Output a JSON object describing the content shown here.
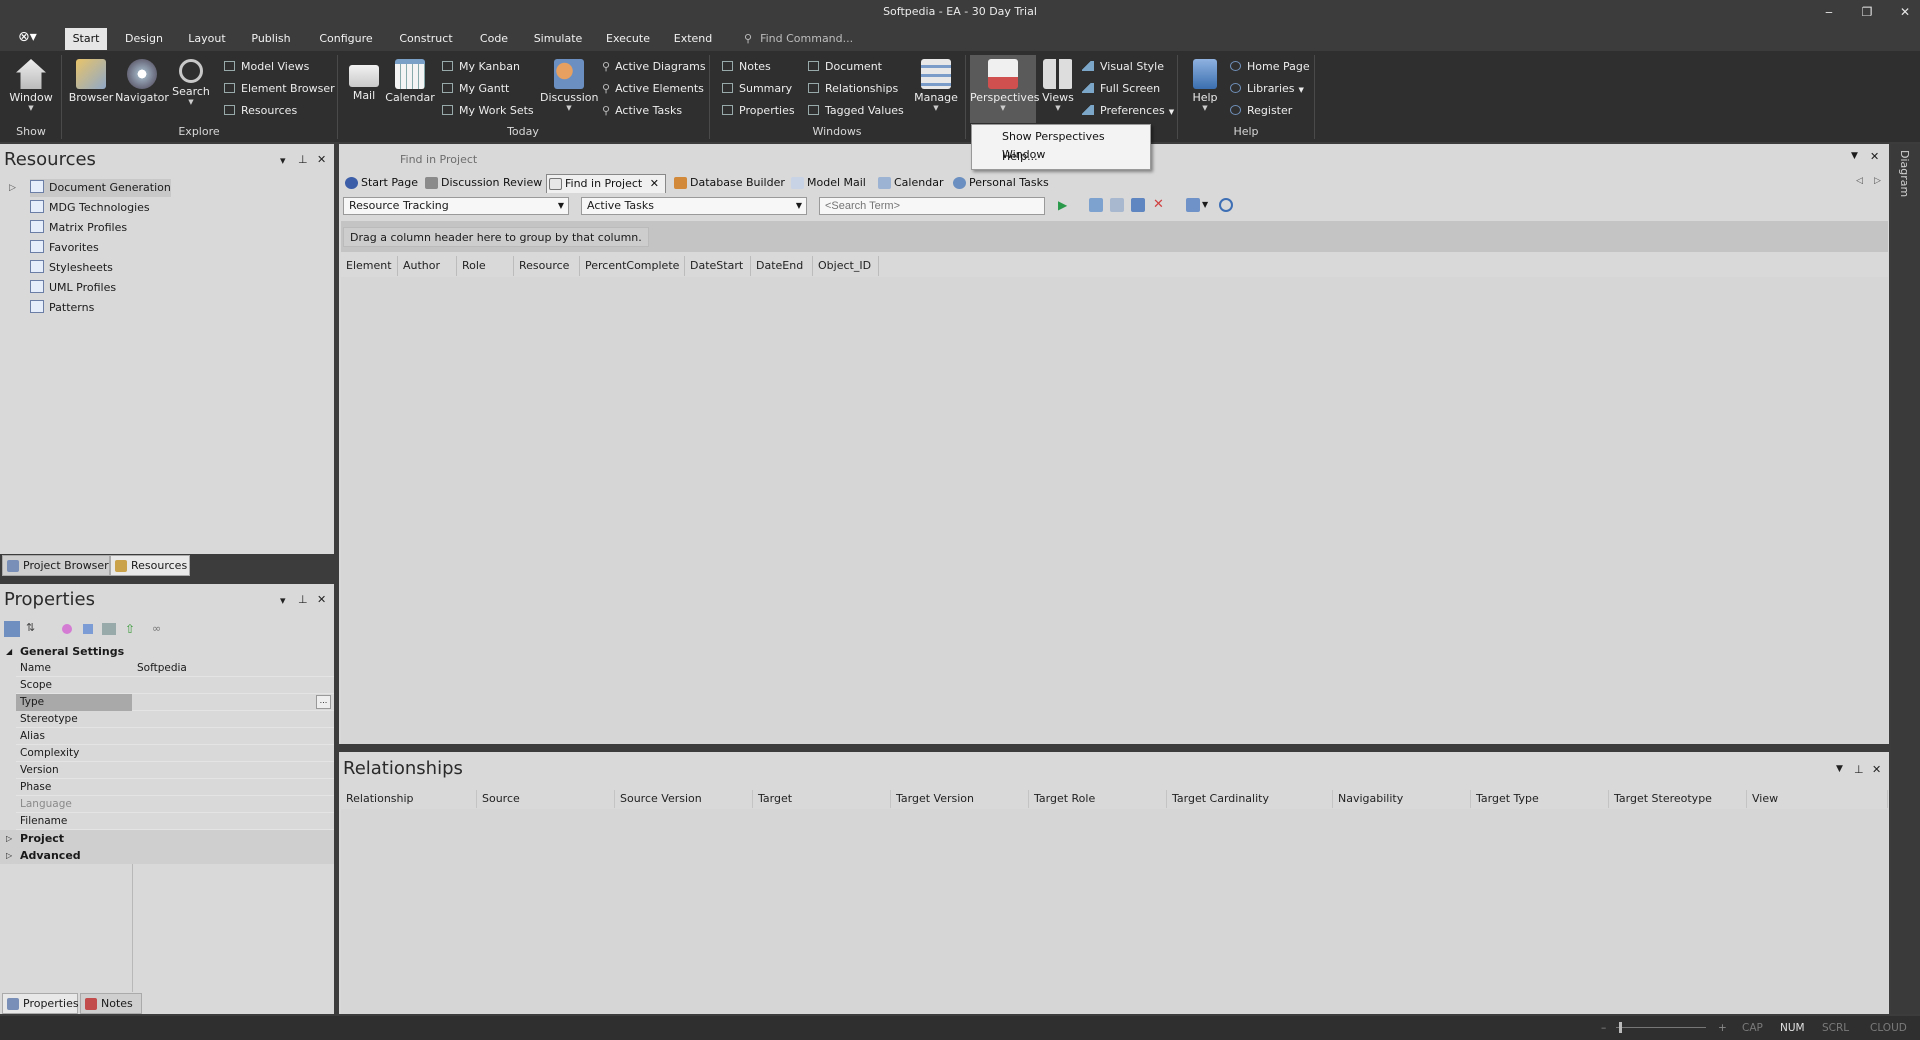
{
  "window": {
    "title": "Softpedia - EA - 30 Day Trial",
    "minimize": "‒",
    "maximize": "❐",
    "close": "✕"
  },
  "ribbon": {
    "tabs": [
      {
        "label": "Start",
        "active": true
      },
      {
        "label": "Design"
      },
      {
        "label": "Layout"
      },
      {
        "label": "Publish"
      },
      {
        "label": "Configure"
      },
      {
        "label": "Construct"
      },
      {
        "label": "Code"
      },
      {
        "label": "Simulate"
      },
      {
        "label": "Execute"
      },
      {
        "label": "Extend"
      }
    ],
    "find_command": "Find Command...",
    "groups": {
      "show": {
        "label": "Show",
        "window": "Window"
      },
      "explore": {
        "label": "Explore",
        "browser": "Browser",
        "navigator": "Navigator",
        "search": "Search",
        "model_views": "Model Views",
        "element_browser": "Element Browser",
        "resources": "Resources"
      },
      "today": {
        "label": "Today",
        "mail": "Mail",
        "calendar": "Calendar",
        "my_kanban": "My Kanban",
        "my_gantt": "My Gantt",
        "my_work_sets": "My Work Sets",
        "discussion": "Discussion",
        "active_diagrams": "Active Diagrams",
        "active_elements": "Active Elements",
        "active_tasks": "Active Tasks"
      },
      "windows": {
        "label": "Windows",
        "notes": "Notes",
        "summary": "Summary",
        "properties": "Properties",
        "document": "Document",
        "relationships": "Relationships",
        "tagged_values": "Tagged Values",
        "manage": "Manage"
      },
      "workspace": {
        "perspectives": "Perspectives",
        "views": "Views",
        "visual_style": "Visual Style",
        "full_screen": "Full Screen",
        "preferences": "Preferences"
      },
      "help": {
        "label": "Help",
        "help": "Help",
        "home_page": "Home Page",
        "libraries": "Libraries",
        "register": "Register"
      }
    },
    "perspectives_menu": [
      "Show Perspectives Window",
      "Help..."
    ]
  },
  "resources": {
    "title": "Resources",
    "items": [
      "Document Generation",
      "MDG Technologies",
      "Matrix Profiles",
      "Favorites",
      "Stylesheets",
      "UML Profiles",
      "Patterns"
    ],
    "tabs": [
      "Project Browser",
      "Resources"
    ]
  },
  "properties": {
    "title": "Properties",
    "general_group": "General Settings",
    "rows": [
      {
        "key": "Name",
        "value": "Softpedia"
      },
      {
        "key": "Scope",
        "value": ""
      },
      {
        "key": "Type",
        "value": ""
      },
      {
        "key": "Stereotype",
        "value": ""
      },
      {
        "key": "Alias",
        "value": ""
      },
      {
        "key": "Complexity",
        "value": ""
      },
      {
        "key": "Version",
        "value": ""
      },
      {
        "key": "Phase",
        "value": ""
      },
      {
        "key": "Language",
        "value": ""
      },
      {
        "key": "Filename",
        "value": ""
      }
    ],
    "type_ellipsis": "...",
    "groups": [
      "Project",
      "Advanced"
    ],
    "tabs": [
      "Properties",
      "Notes"
    ]
  },
  "main": {
    "find_title": "Find in Project",
    "doc_tabs": [
      "Start Page",
      "Discussion Review",
      "Find in Project",
      "Database Builder",
      "Model Mail",
      "Calendar",
      "Personal Tasks"
    ],
    "search_scope": "Resource Tracking",
    "search_name": "Active Tasks",
    "search_placeholder": "<Search Term>",
    "group_hint": "Drag a column header here to group by that column.",
    "columns": [
      "Element",
      "Author",
      "Role",
      "Resource",
      "PercentComplete",
      "DateStart",
      "DateEnd",
      "Object_ID"
    ]
  },
  "relationships": {
    "title": "Relationships",
    "columns": [
      "Relationship",
      "Source",
      "Source Version",
      "Target",
      "Target Version",
      "Target Role",
      "Target Cardinality",
      "Navigability",
      "Target Type",
      "Target Stereotype",
      "View"
    ]
  },
  "diagram_sidebar": "Diagram",
  "status": {
    "minus": "–",
    "plus": "+",
    "cap": "CAP",
    "num": "NUM",
    "scrl": "SCRL",
    "cloud": "CLOUD"
  },
  "colors": {
    "ribbon_bg": "#2f2f2f",
    "panel_bg": "#d9d9d9",
    "active_tab": "#e6e6e6"
  }
}
